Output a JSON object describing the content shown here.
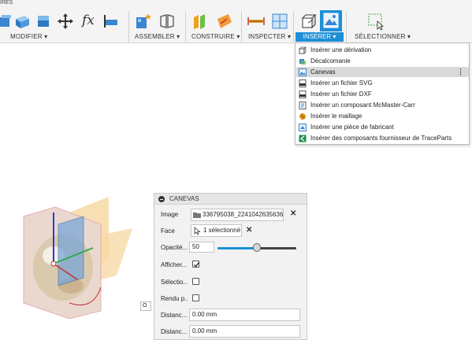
{
  "toolbar": {
    "top_fragment": "IRES",
    "groups": [
      {
        "label": "MODIFIER ▾"
      },
      {
        "label": "ASSEMBLER ▾"
      },
      {
        "label": "CONSTRUIRE ▾"
      },
      {
        "label": "INSPECTER ▾"
      },
      {
        "label": "INSÉRER ▾"
      },
      {
        "label": "SÉLECTIONNER ▾"
      }
    ],
    "fx_label": "fx"
  },
  "insert_menu": {
    "items": [
      {
        "label": "Insérer une dérivation",
        "icon": "derive-icon"
      },
      {
        "label": "Décalcomanie",
        "icon": "decal-icon"
      },
      {
        "label": "Canevas",
        "icon": "canvas-icon",
        "highlighted": true
      },
      {
        "label": "Insérer un fichier SVG",
        "icon": "svg-file-icon"
      },
      {
        "label": "Insérer un fichier DXF",
        "icon": "dxf-file-icon"
      },
      {
        "label": "Insérer un composant McMaster-Carr",
        "icon": "mcmaster-icon"
      },
      {
        "label": "Insérer le maillage",
        "icon": "mesh-icon"
      },
      {
        "label": "Insérer une pièce de fabricant",
        "icon": "manufacturer-part-icon"
      },
      {
        "label": "Insérer des composants fournisseur de TraceParts",
        "icon": "traceparts-icon"
      }
    ],
    "more": "⋮"
  },
  "canvas_panel": {
    "title": "CANEVAS",
    "image_label": "Image",
    "image_value": "336795038_2241042635636...",
    "face_label": "Face",
    "face_value": "1 sélectionné",
    "opacity_label": "Opacité...",
    "opacity_value": "50",
    "opacity": 50,
    "show_label": "Afficher...",
    "show_checked": true,
    "select_label": "Sélectio...",
    "select_checked": false,
    "render_label": "Rendu p...",
    "render_checked": false,
    "dist1_label": "Distanc...",
    "dist1_value": "0.00 mm",
    "dist2_label": "Distanc...",
    "dist2_value": "0.00 mm",
    "remove": "✕"
  },
  "tiny_label": "O"
}
